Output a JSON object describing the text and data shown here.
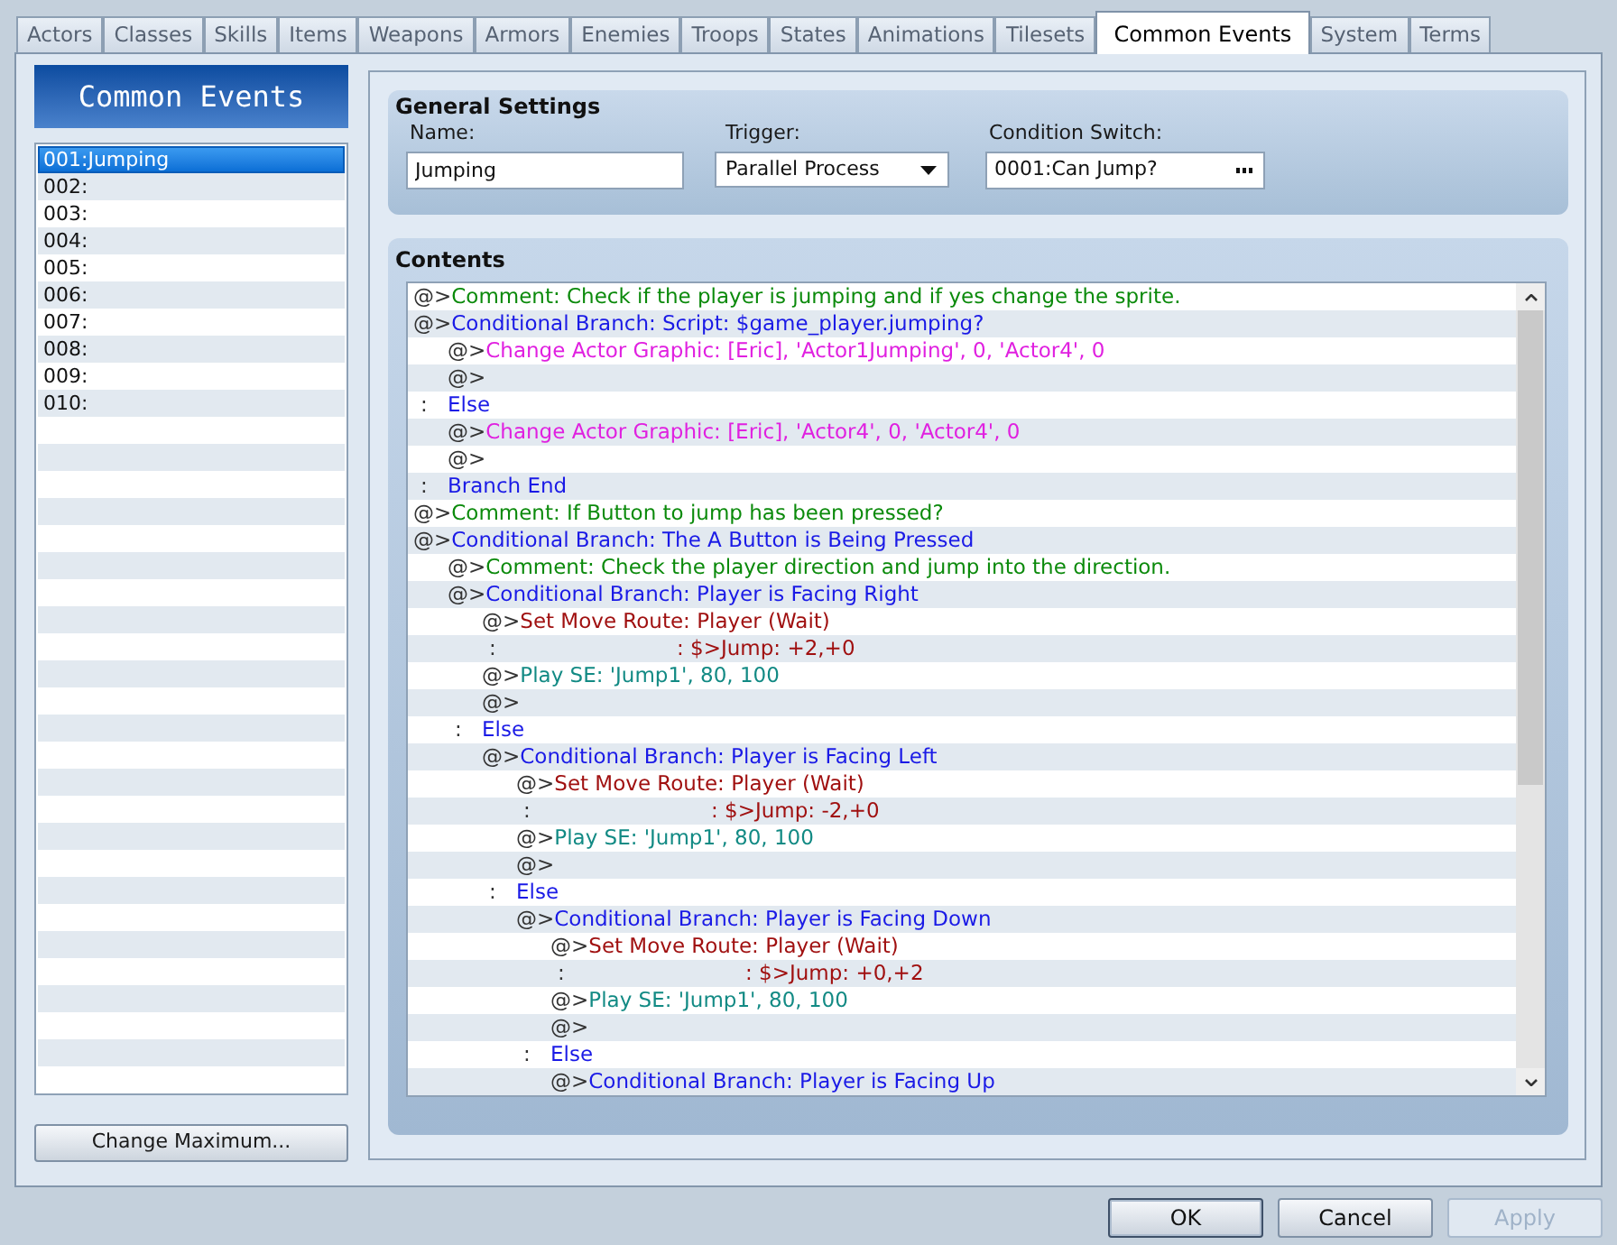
{
  "tabs": [
    {
      "label": "Actors",
      "selected": false
    },
    {
      "label": "Classes",
      "selected": false
    },
    {
      "label": "Skills",
      "selected": false
    },
    {
      "label": "Items",
      "selected": false
    },
    {
      "label": "Weapons",
      "selected": false
    },
    {
      "label": "Armors",
      "selected": false
    },
    {
      "label": "Enemies",
      "selected": false
    },
    {
      "label": "Troops",
      "selected": false
    },
    {
      "label": "States",
      "selected": false
    },
    {
      "label": "Animations",
      "selected": false
    },
    {
      "label": "Tilesets",
      "selected": false
    },
    {
      "label": "Common Events",
      "selected": true
    },
    {
      "label": "System",
      "selected": false
    },
    {
      "label": "Terms",
      "selected": false
    }
  ],
  "event_list": {
    "title": "Common Events",
    "items": [
      {
        "label": "001:Jumping",
        "selected": true
      },
      {
        "label": "002:",
        "selected": false
      },
      {
        "label": "003:",
        "selected": false
      },
      {
        "label": "004:",
        "selected": false
      },
      {
        "label": "005:",
        "selected": false
      },
      {
        "label": "006:",
        "selected": false
      },
      {
        "label": "007:",
        "selected": false
      },
      {
        "label": "008:",
        "selected": false
      },
      {
        "label": "009:",
        "selected": false
      },
      {
        "label": "010:",
        "selected": false
      }
    ]
  },
  "change_maximum_button": {
    "label": "Change Maximum..."
  },
  "general_settings": {
    "title": "General Settings",
    "name": {
      "label": "Name:",
      "value": "Jumping"
    },
    "trigger": {
      "label": "Trigger:",
      "value": "Parallel Process"
    },
    "condition_switch": {
      "label": "Condition Switch:",
      "value": "0001:Can Jump?"
    }
  },
  "contents": {
    "title": "Contents",
    "commands": [
      {
        "kind": "comment",
        "marker": "@>",
        "text": "Comment: Check if the player is jumping and if yes change the sprite."
      },
      {
        "kind": "branch",
        "marker": "@>",
        "text": "Conditional Branch: Script: $game_player.jumping?",
        "children": [
          {
            "kind": "graphic",
            "marker": "@>",
            "text": "Change Actor Graphic: [Eric], 'Actor1Jumping', 0, 'Actor4', 0"
          },
          {
            "kind": "empty",
            "marker": "@>"
          }
        ]
      },
      {
        "kind": "else",
        "marker": ":",
        "text": "Else",
        "children": [
          {
            "kind": "graphic",
            "marker": "@>",
            "text": "Change Actor Graphic: [Eric], 'Actor4', 0, 'Actor4', 0"
          },
          {
            "kind": "empty",
            "marker": "@>"
          }
        ]
      },
      {
        "kind": "else",
        "marker": ":",
        "text": "Branch End"
      },
      {
        "kind": "comment",
        "marker": "@>",
        "text": "Comment: If Button to jump has been pressed?"
      },
      {
        "kind": "branch",
        "marker": "@>",
        "text": "Conditional Branch: The A Button is Being Pressed",
        "children": [
          {
            "kind": "comment",
            "marker": "@>",
            "text": "Comment: Check the player direction and jump into the direction."
          },
          {
            "kind": "branch",
            "marker": "@>",
            "text": "Conditional Branch: Player is Facing Right",
            "children": [
              {
                "kind": "route",
                "marker": "@>",
                "text": "Set Move Route: Player (Wait)"
              },
              {
                "kind": "route_step",
                "marker": ":",
                "text": ": $>Jump: +2,+0"
              },
              {
                "kind": "sound",
                "marker": "@>",
                "text": "Play SE: 'Jump1', 80, 100"
              },
              {
                "kind": "empty",
                "marker": "@>"
              }
            ]
          },
          {
            "kind": "else",
            "marker": ":",
            "text": "Else",
            "children": [
              {
                "kind": "branch",
                "marker": "@>",
                "text": "Conditional Branch: Player is Facing Left",
                "children": [
                  {
                    "kind": "route",
                    "marker": "@>",
                    "text": "Set Move Route: Player (Wait)"
                  },
                  {
                    "kind": "route_step",
                    "marker": ":",
                    "text": ": $>Jump: -2,+0"
                  },
                  {
                    "kind": "sound",
                    "marker": "@>",
                    "text": "Play SE: 'Jump1', 80, 100"
                  },
                  {
                    "kind": "empty",
                    "marker": "@>"
                  }
                ]
              },
              {
                "kind": "else",
                "marker": ":",
                "text": "Else",
                "children": [
                  {
                    "kind": "branch",
                    "marker": "@>",
                    "text": "Conditional Branch: Player is Facing Down",
                    "children": [
                      {
                        "kind": "route",
                        "marker": "@>",
                        "text": "Set Move Route: Player (Wait)"
                      },
                      {
                        "kind": "route_step",
                        "marker": ":",
                        "text": ": $>Jump: +0,+2"
                      },
                      {
                        "kind": "sound",
                        "marker": "@>",
                        "text": "Play SE: 'Jump1', 80, 100"
                      },
                      {
                        "kind": "empty",
                        "marker": "@>"
                      }
                    ]
                  },
                  {
                    "kind": "else",
                    "marker": ":",
                    "text": "Else",
                    "children": [
                      {
                        "kind": "branch",
                        "marker": "@>",
                        "text": "Conditional Branch: Player is Facing Up"
                      }
                    ]
                  }
                ]
              }
            ]
          }
        ]
      }
    ]
  },
  "buttons": [
    {
      "label": "OK",
      "default": true,
      "disabled": false
    },
    {
      "label": "Cancel",
      "default": false,
      "disabled": false
    },
    {
      "label": "Apply",
      "default": false,
      "disabled": true
    }
  ]
}
